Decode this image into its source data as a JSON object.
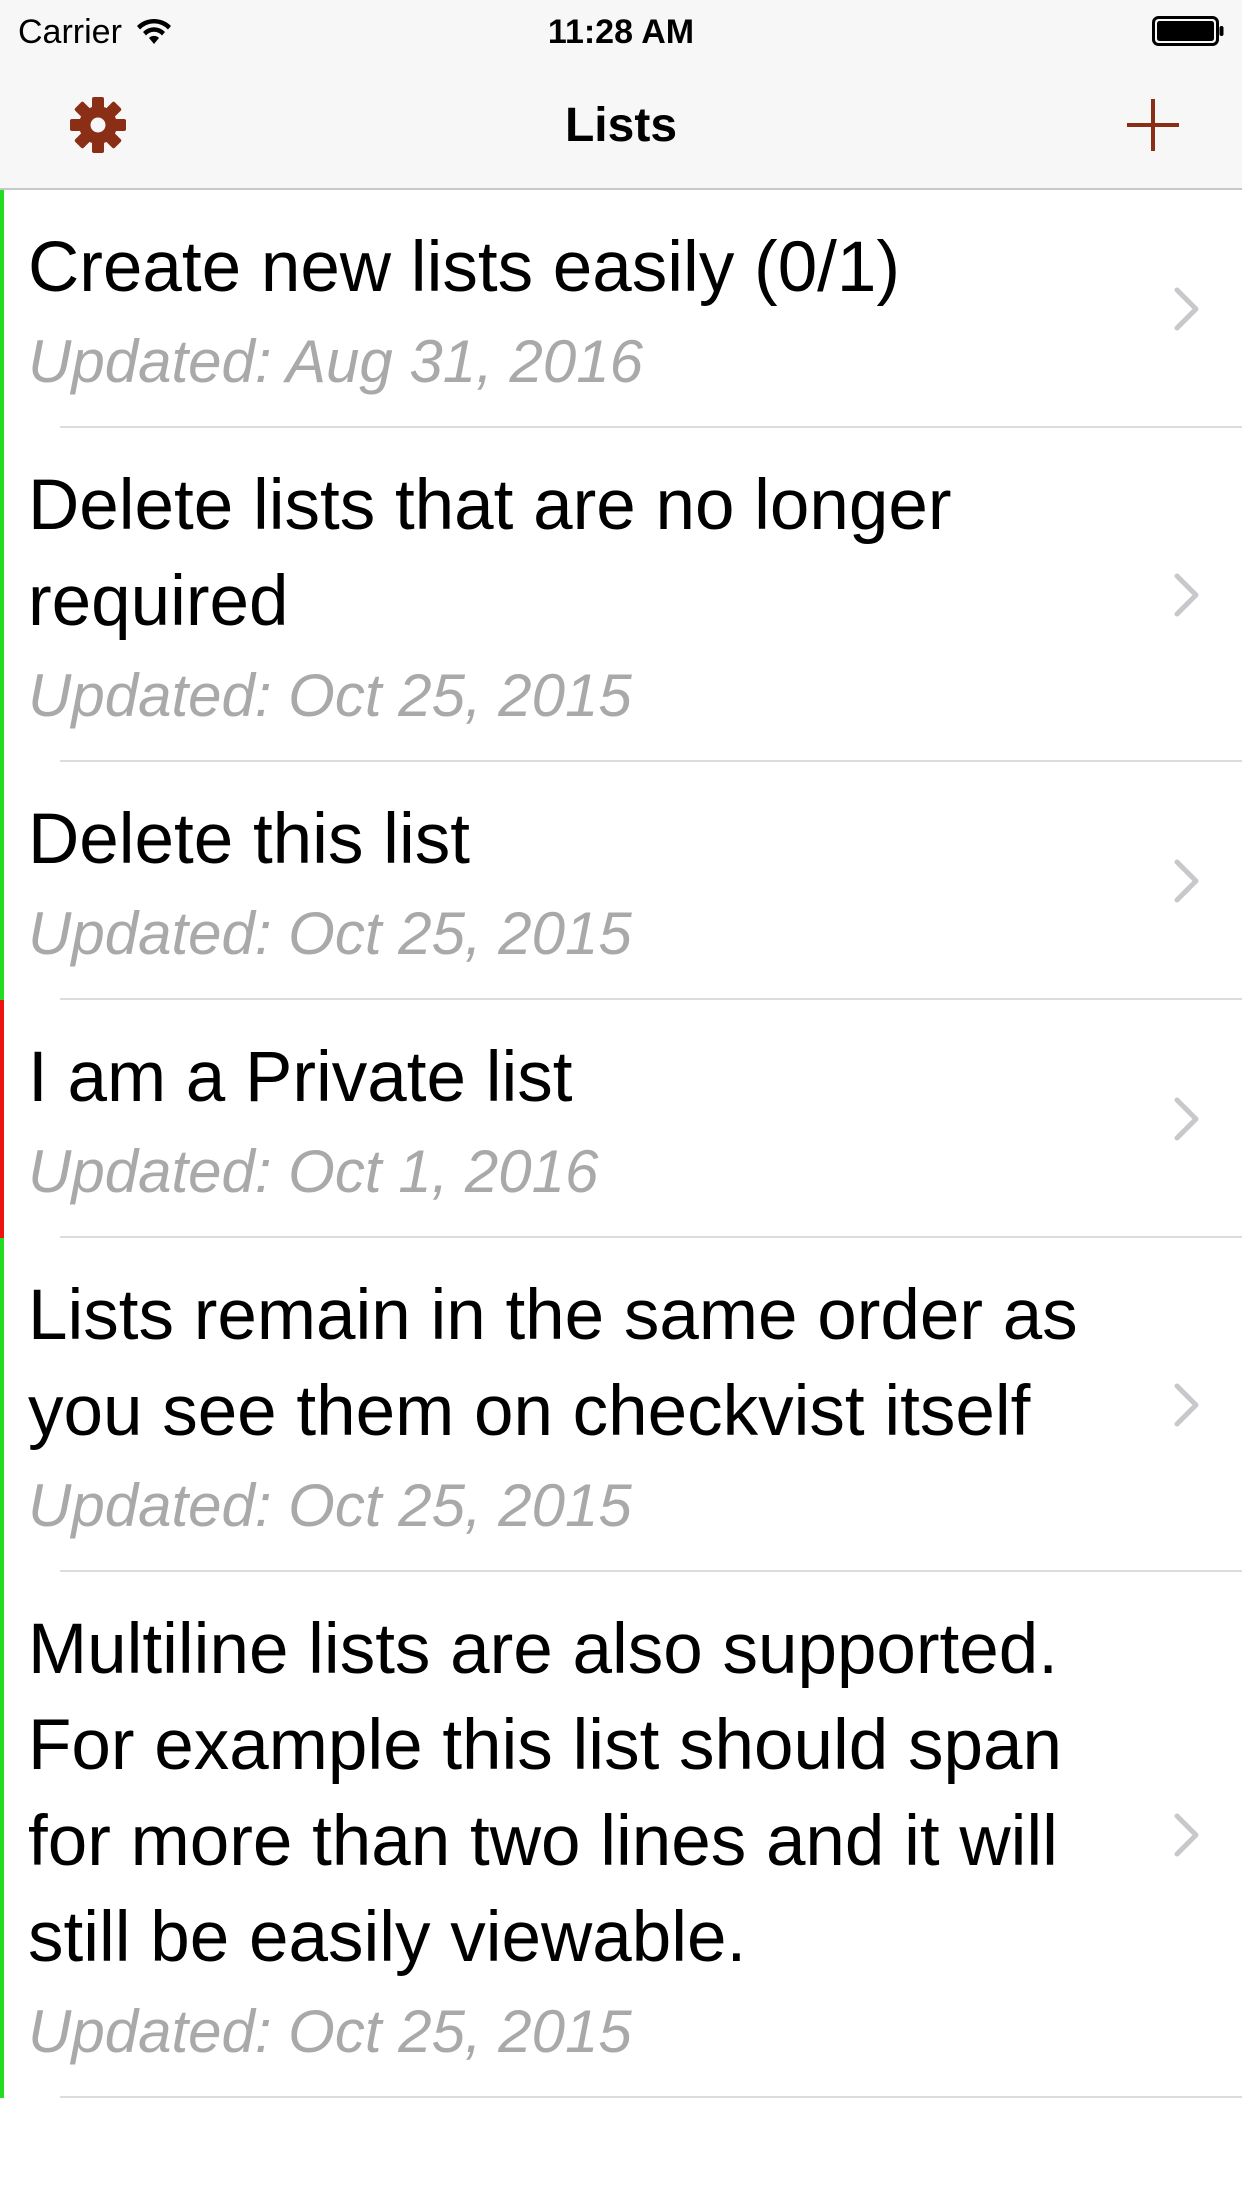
{
  "status_bar": {
    "carrier": "Carrier",
    "time": "11:28 AM"
  },
  "nav": {
    "title": "Lists",
    "settings_icon": "gear-icon",
    "add_icon": "plus-icon"
  },
  "colors": {
    "accent": "#8b2e16",
    "shared_indicator": "#22dd22",
    "private_indicator": "#ee1111",
    "subtitle": "#a9a9a9"
  },
  "lists": [
    {
      "title": "Create new lists easily (0/1)",
      "updated": "Updated: Aug 31, 2016",
      "indicator": "#22dd22"
    },
    {
      "title": "Delete lists that are no longer required",
      "updated": "Updated: Oct 25, 2015",
      "indicator": "#22dd22"
    },
    {
      "title": "Delete this list",
      "updated": "Updated: Oct 25, 2015",
      "indicator": "#22dd22"
    },
    {
      "title": "I am a Private list",
      "updated": "Updated: Oct 1, 2016",
      "indicator": "#ee1111"
    },
    {
      "title": "Lists remain in the same order as you see them on checkvist itself",
      "updated": "Updated: Oct 25, 2015",
      "indicator": "#22dd22"
    },
    {
      "title": "Multiline lists are also supported. For example this list should span for more than two lines and it will still be easily viewable.",
      "updated": "Updated: Oct 25, 2015",
      "indicator": "#22dd22"
    }
  ]
}
